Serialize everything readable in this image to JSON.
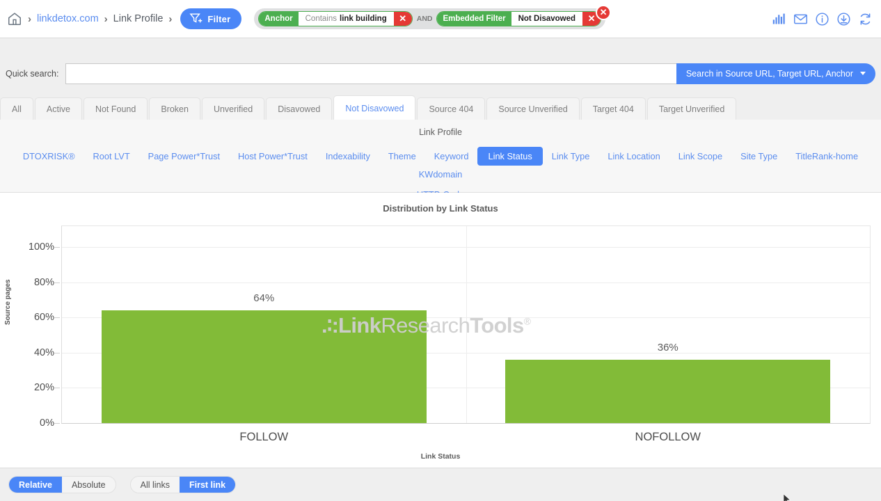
{
  "topbar": {
    "home_icon": "home-icon",
    "breadcrumb": [
      {
        "label": "linkdetox.com",
        "type": "link"
      },
      {
        "label": "Link Profile",
        "type": "text"
      }
    ],
    "separator": "›",
    "filter_button": {
      "label": "Filter",
      "icon": "funnel-plus-icon"
    },
    "filter_chips": [
      {
        "key": "Anchor",
        "operator": "Contains",
        "value": "link building",
        "remove": "✕"
      },
      {
        "key": "Embedded Filter",
        "operator": "",
        "value": "Not Disavowed",
        "remove": "✕"
      }
    ],
    "chip_conjunction": "AND",
    "pill_close": "✕",
    "icons": [
      "bar-chart-icon",
      "envelope-icon",
      "info-circle-icon",
      "download-circle-icon",
      "refresh-icon"
    ]
  },
  "quick_search": {
    "label": "Quick search:",
    "value": "",
    "placeholder": "",
    "button_label": "Search in Source URL, Target URL, Anchor"
  },
  "tabs": [
    {
      "label": "All",
      "active": false
    },
    {
      "label": "Active",
      "active": false
    },
    {
      "label": "Not Found",
      "active": false
    },
    {
      "label": "Broken",
      "active": false
    },
    {
      "label": "Unverified",
      "active": false
    },
    {
      "label": "Disavowed",
      "active": false
    },
    {
      "label": "Not Disavowed",
      "active": true
    },
    {
      "label": "Source 404",
      "active": false
    },
    {
      "label": "Source Unverified",
      "active": false
    },
    {
      "label": "Target 404",
      "active": false
    },
    {
      "label": "Target Unverified",
      "active": false
    }
  ],
  "subnav": {
    "title": "Link Profile",
    "row1": [
      {
        "label": "DTOXRISK®",
        "active": false
      },
      {
        "label": "Root LVT",
        "active": false
      },
      {
        "label": "Page Power*Trust",
        "active": false
      },
      {
        "label": "Host Power*Trust",
        "active": false
      },
      {
        "label": "Indexability",
        "active": false
      },
      {
        "label": "Theme",
        "active": false
      },
      {
        "label": "Keyword",
        "active": false
      },
      {
        "label": "Link Status",
        "active": true
      },
      {
        "label": "Link Type",
        "active": false
      },
      {
        "label": "Link Location",
        "active": false
      },
      {
        "label": "Link Scope",
        "active": false
      },
      {
        "label": "Site Type",
        "active": false
      },
      {
        "label": "TitleRank-home",
        "active": false
      },
      {
        "label": "KWdomain",
        "active": false
      }
    ],
    "row2": [
      {
        "label": "HTTP-Code",
        "active": false
      }
    ]
  },
  "watermark": {
    "dots": ".∶:",
    "part1": "Link",
    "part2": "Research",
    "part3": "Tools",
    "reg": "®"
  },
  "chart_data": {
    "type": "bar",
    "title": "Distribution by Link Status",
    "xlabel": "Link Status",
    "ylabel": "Source pages",
    "categories": [
      "FOLLOW",
      "NOFOLLOW"
    ],
    "values": [
      64,
      36
    ],
    "data_labels": [
      "64%",
      "36%"
    ],
    "ytick_labels": [
      "0%",
      "20%",
      "40%",
      "60%",
      "80%",
      "100%"
    ],
    "ytick_values": [
      0,
      20,
      40,
      60,
      80,
      100
    ],
    "ylim": [
      0,
      112
    ],
    "grid": true,
    "legend": "none",
    "bar_color": "#82bb38"
  },
  "bottom": {
    "scale_toggle": [
      {
        "label": "Relative",
        "active": true
      },
      {
        "label": "Absolute",
        "active": false
      }
    ],
    "links_toggle": [
      {
        "label": "All links",
        "active": false
      },
      {
        "label": "First link",
        "active": true
      }
    ]
  }
}
